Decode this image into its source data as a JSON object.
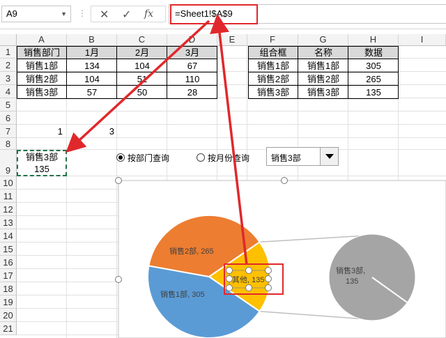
{
  "formula_bar": {
    "name_box": "A9",
    "formula": "=Sheet1!$A$9",
    "fx_icon": "fx"
  },
  "columns": [
    "A",
    "B",
    "C",
    "D",
    "E",
    "F",
    "G",
    "H",
    "I"
  ],
  "rows": [
    "1",
    "2",
    "3",
    "4",
    "5",
    "6",
    "7",
    "8",
    "9",
    "10",
    "11",
    "12",
    "13",
    "14",
    "15",
    "16",
    "17",
    "18",
    "19",
    "20",
    "21"
  ],
  "table1": {
    "headers": [
      "销售部门",
      "1月",
      "2月",
      "3月"
    ],
    "rows": [
      [
        "销售1部",
        "134",
        "104",
        "67"
      ],
      [
        "销售2部",
        "104",
        "51",
        "110"
      ],
      [
        "销售3部",
        "57",
        "50",
        "28"
      ]
    ]
  },
  "table2": {
    "headers": [
      "组合框",
      "名称",
      "数据"
    ],
    "rows": [
      [
        "销售1部",
        "销售1部",
        "305"
      ],
      [
        "销售2部",
        "销售2部",
        "265"
      ],
      [
        "销售3部",
        "销售3部",
        "135"
      ]
    ]
  },
  "cells": {
    "a7": "1",
    "c7": "3",
    "a9_line1": "销售3部",
    "a9_line2": "135"
  },
  "controls": {
    "radio1_label": "按部门查询",
    "radio1_checked": true,
    "radio2_label": "按月份查询",
    "radio2_checked": false,
    "combo_value": "销售3部"
  },
  "chart_data": {
    "type": "pie",
    "variant": "pie-of-pie",
    "main_pie": [
      {
        "label": "销售2部, 265",
        "name": "销售2部",
        "value": 265,
        "color": "#ed7d31"
      },
      {
        "label": "其他, 135",
        "name": "其他",
        "value": 135,
        "color": "#ffc000"
      },
      {
        "label": "销售1部, 305",
        "name": "销售1部",
        "value": 305,
        "color": "#5b9bd5"
      }
    ],
    "secondary_pie": [
      {
        "label_line1": "销售3部,",
        "label_line2": "135",
        "name": "销售3部",
        "value": 135,
        "color": "#a5a5a5"
      }
    ]
  },
  "colors": {
    "annotation_red": "#e0282c",
    "selection_green": "#217346"
  }
}
